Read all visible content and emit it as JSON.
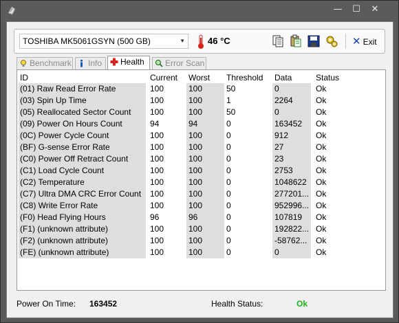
{
  "window": {
    "minimize_glyph": "—",
    "maximize_glyph": "☐",
    "close_glyph": "✕"
  },
  "toolbar": {
    "drive": "TOSHIBA MK5061GSYN (500 GB)",
    "temperature": "46 °C",
    "exit_label": "Exit",
    "icons": [
      "copy-icon",
      "paste-icon",
      "save-icon",
      "settings-icon",
      "exit-icon"
    ]
  },
  "tabs": [
    {
      "label": "Benchmark",
      "icon": "lightbulb-icon",
      "active": false
    },
    {
      "label": "Info",
      "icon": "info-icon",
      "active": false
    },
    {
      "label": "Health",
      "icon": "health-cross-icon",
      "active": true
    },
    {
      "label": "Error Scan",
      "icon": "magnifier-icon",
      "active": false
    }
  ],
  "table": {
    "headers": {
      "id": "ID",
      "current": "Current",
      "worst": "Worst",
      "threshold": "Threshold",
      "data": "Data",
      "status": "Status"
    },
    "rows": [
      {
        "id": "(01) Raw Read Error Rate",
        "current": "100",
        "worst": "100",
        "threshold": "50",
        "data": "0",
        "status": "Ok"
      },
      {
        "id": "(03) Spin Up Time",
        "current": "100",
        "worst": "100",
        "threshold": "1",
        "data": "2264",
        "status": "Ok"
      },
      {
        "id": "(05) Reallocated Sector Count",
        "current": "100",
        "worst": "100",
        "threshold": "50",
        "data": "0",
        "status": "Ok"
      },
      {
        "id": "(09) Power On Hours Count",
        "current": "94",
        "worst": "94",
        "threshold": "0",
        "data": "163452",
        "status": "Ok"
      },
      {
        "id": "(0C) Power Cycle Count",
        "current": "100",
        "worst": "100",
        "threshold": "0",
        "data": "912",
        "status": "Ok"
      },
      {
        "id": "(BF) G-sense Error Rate",
        "current": "100",
        "worst": "100",
        "threshold": "0",
        "data": "27",
        "status": "Ok"
      },
      {
        "id": "(C0) Power Off Retract Count",
        "current": "100",
        "worst": "100",
        "threshold": "0",
        "data": "23",
        "status": "Ok"
      },
      {
        "id": "(C1) Load Cycle Count",
        "current": "100",
        "worst": "100",
        "threshold": "0",
        "data": "2753",
        "status": "Ok"
      },
      {
        "id": "(C2) Temperature",
        "current": "100",
        "worst": "100",
        "threshold": "0",
        "data": "1048622",
        "status": "Ok"
      },
      {
        "id": "(C7) Ultra DMA CRC Error Count",
        "current": "100",
        "worst": "100",
        "threshold": "0",
        "data": "277201...",
        "status": "Ok"
      },
      {
        "id": "(C8) Write Error Rate",
        "current": "100",
        "worst": "100",
        "threshold": "0",
        "data": "952996...",
        "status": "Ok"
      },
      {
        "id": "(F0) Head Flying Hours",
        "current": "96",
        "worst": "96",
        "threshold": "0",
        "data": "107819",
        "status": "Ok"
      },
      {
        "id": "(F1) (unknown attribute)",
        "current": "100",
        "worst": "100",
        "threshold": "0",
        "data": "192822...",
        "status": "Ok"
      },
      {
        "id": "(F2) (unknown attribute)",
        "current": "100",
        "worst": "100",
        "threshold": "0",
        "data": "-58762...",
        "status": "Ok"
      },
      {
        "id": "(FE) (unknown attribute)",
        "current": "100",
        "worst": "100",
        "threshold": "0",
        "data": "0",
        "status": "Ok"
      }
    ]
  },
  "status": {
    "power_on_label": "Power On Time:",
    "power_on_value": "163452",
    "health_label": "Health Status:",
    "health_value": "Ok",
    "health_color": "#1db51d"
  },
  "colors": {
    "titlebar": "#5b5b5b",
    "shade_column": "#dedede",
    "exit_accent": "#1a3fb5",
    "thermometer": "#d8231f"
  }
}
